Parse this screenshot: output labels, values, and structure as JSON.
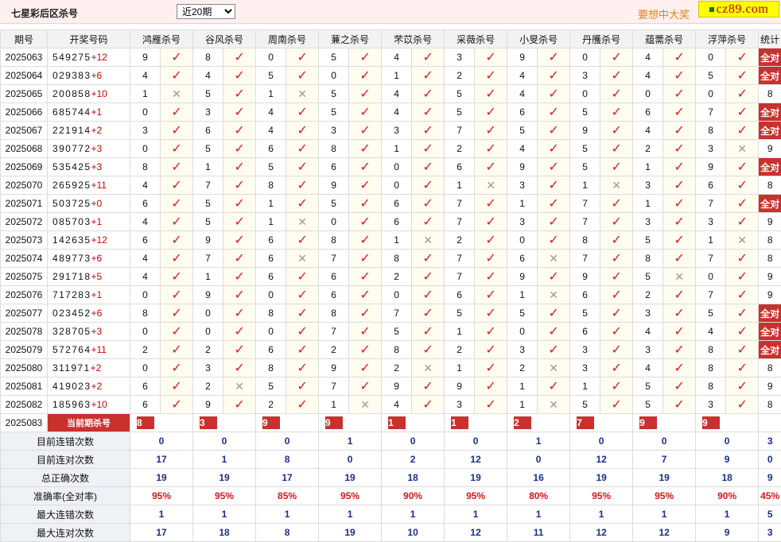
{
  "header": {
    "title": "七星彩后区杀号",
    "period_option": "近20期",
    "promo_text": "要想中大奖",
    "logo_text": "cz89.com"
  },
  "columns": {
    "issue": "期号",
    "draw": "开奖号码",
    "experts": [
      "鸿雁杀号",
      "谷风杀号",
      "周南杀号",
      "蒹之杀号",
      "芣苡杀号",
      "采薇杀号",
      "小旻杀号",
      "丹雘杀号",
      "蕴薷杀号",
      "浮萍杀号"
    ],
    "total": "统计"
  },
  "rows": [
    {
      "issue": "2025063",
      "draw": "549275",
      "plus": "+12",
      "kills": [
        [
          9,
          1
        ],
        [
          8,
          1
        ],
        [
          0,
          1
        ],
        [
          5,
          1
        ],
        [
          4,
          1
        ],
        [
          3,
          1
        ],
        [
          9,
          1
        ],
        [
          0,
          1
        ],
        [
          4,
          1
        ],
        [
          0,
          1
        ]
      ],
      "total": "全对"
    },
    {
      "issue": "2025064",
      "draw": "029383",
      "plus": "+6",
      "kills": [
        [
          4,
          1
        ],
        [
          4,
          1
        ],
        [
          5,
          1
        ],
        [
          0,
          1
        ],
        [
          1,
          1
        ],
        [
          2,
          1
        ],
        [
          4,
          1
        ],
        [
          3,
          1
        ],
        [
          4,
          1
        ],
        [
          5,
          1
        ]
      ],
      "total": "全对"
    },
    {
      "issue": "2025065",
      "draw": "200858",
      "plus": "+10",
      "kills": [
        [
          1,
          0
        ],
        [
          5,
          1
        ],
        [
          1,
          0
        ],
        [
          5,
          1
        ],
        [
          4,
          1
        ],
        [
          5,
          1
        ],
        [
          4,
          1
        ],
        [
          0,
          1
        ],
        [
          0,
          1
        ],
        [
          0,
          1
        ]
      ],
      "total": "8"
    },
    {
      "issue": "2025066",
      "draw": "685744",
      "plus": "+1",
      "kills": [
        [
          0,
          1
        ],
        [
          3,
          1
        ],
        [
          4,
          1
        ],
        [
          5,
          1
        ],
        [
          4,
          1
        ],
        [
          5,
          1
        ],
        [
          6,
          1
        ],
        [
          5,
          1
        ],
        [
          6,
          1
        ],
        [
          7,
          1
        ]
      ],
      "total": "全对"
    },
    {
      "issue": "2025067",
      "draw": "221914",
      "plus": "+2",
      "kills": [
        [
          3,
          1
        ],
        [
          6,
          1
        ],
        [
          4,
          1
        ],
        [
          3,
          1
        ],
        [
          3,
          1
        ],
        [
          7,
          1
        ],
        [
          5,
          1
        ],
        [
          9,
          1
        ],
        [
          4,
          1
        ],
        [
          8,
          1
        ]
      ],
      "total": "全对"
    },
    {
      "issue": "2025068",
      "draw": "390772",
      "plus": "+3",
      "kills": [
        [
          0,
          1
        ],
        [
          5,
          1
        ],
        [
          6,
          1
        ],
        [
          8,
          1
        ],
        [
          1,
          1
        ],
        [
          2,
          1
        ],
        [
          4,
          1
        ],
        [
          5,
          1
        ],
        [
          2,
          1
        ],
        [
          3,
          0
        ]
      ],
      "total": "9"
    },
    {
      "issue": "2025069",
      "draw": "535425",
      "plus": "+3",
      "kills": [
        [
          8,
          1
        ],
        [
          1,
          1
        ],
        [
          5,
          1
        ],
        [
          6,
          1
        ],
        [
          0,
          1
        ],
        [
          6,
          1
        ],
        [
          9,
          1
        ],
        [
          5,
          1
        ],
        [
          1,
          1
        ],
        [
          9,
          1
        ]
      ],
      "total": "全对"
    },
    {
      "issue": "2025070",
      "draw": "265925",
      "plus": "+11",
      "kills": [
        [
          4,
          1
        ],
        [
          7,
          1
        ],
        [
          8,
          1
        ],
        [
          9,
          1
        ],
        [
          0,
          1
        ],
        [
          1,
          0
        ],
        [
          3,
          1
        ],
        [
          1,
          0
        ],
        [
          3,
          1
        ],
        [
          6,
          1
        ]
      ],
      "total": "8"
    },
    {
      "issue": "2025071",
      "draw": "503725",
      "plus": "+0",
      "kills": [
        [
          6,
          1
        ],
        [
          5,
          1
        ],
        [
          1,
          1
        ],
        [
          5,
          1
        ],
        [
          6,
          1
        ],
        [
          7,
          1
        ],
        [
          1,
          1
        ],
        [
          7,
          1
        ],
        [
          1,
          1
        ],
        [
          7,
          1
        ]
      ],
      "total": "全对"
    },
    {
      "issue": "2025072",
      "draw": "085703",
      "plus": "+1",
      "kills": [
        [
          4,
          1
        ],
        [
          5,
          1
        ],
        [
          1,
          0
        ],
        [
          0,
          1
        ],
        [
          6,
          1
        ],
        [
          7,
          1
        ],
        [
          3,
          1
        ],
        [
          7,
          1
        ],
        [
          3,
          1
        ],
        [
          3,
          1
        ]
      ],
      "total": "9"
    },
    {
      "issue": "2025073",
      "draw": "142635",
      "plus": "+12",
      "kills": [
        [
          6,
          1
        ],
        [
          9,
          1
        ],
        [
          6,
          1
        ],
        [
          8,
          1
        ],
        [
          1,
          0
        ],
        [
          2,
          1
        ],
        [
          0,
          1
        ],
        [
          8,
          1
        ],
        [
          5,
          1
        ],
        [
          1,
          0
        ]
      ],
      "total": "8"
    },
    {
      "issue": "2025074",
      "draw": "489773",
      "plus": "+6",
      "kills": [
        [
          4,
          1
        ],
        [
          7,
          1
        ],
        [
          6,
          0
        ],
        [
          7,
          1
        ],
        [
          8,
          1
        ],
        [
          7,
          1
        ],
        [
          6,
          0
        ],
        [
          7,
          1
        ],
        [
          8,
          1
        ],
        [
          7,
          1
        ]
      ],
      "total": "8"
    },
    {
      "issue": "2025075",
      "draw": "291718",
      "plus": "+5",
      "kills": [
        [
          4,
          1
        ],
        [
          1,
          1
        ],
        [
          6,
          1
        ],
        [
          6,
          1
        ],
        [
          2,
          1
        ],
        [
          7,
          1
        ],
        [
          9,
          1
        ],
        [
          9,
          1
        ],
        [
          5,
          0
        ],
        [
          0,
          1
        ]
      ],
      "total": "9"
    },
    {
      "issue": "2025076",
      "draw": "717283",
      "plus": "+1",
      "kills": [
        [
          0,
          1
        ],
        [
          9,
          1
        ],
        [
          0,
          1
        ],
        [
          6,
          1
        ],
        [
          0,
          1
        ],
        [
          6,
          1
        ],
        [
          1,
          0
        ],
        [
          6,
          1
        ],
        [
          2,
          1
        ],
        [
          7,
          1
        ]
      ],
      "total": "9"
    },
    {
      "issue": "2025077",
      "draw": "023452",
      "plus": "+6",
      "kills": [
        [
          8,
          1
        ],
        [
          0,
          1
        ],
        [
          8,
          1
        ],
        [
          8,
          1
        ],
        [
          7,
          1
        ],
        [
          5,
          1
        ],
        [
          5,
          1
        ],
        [
          5,
          1
        ],
        [
          3,
          1
        ],
        [
          5,
          1
        ]
      ],
      "total": "全对"
    },
    {
      "issue": "2025078",
      "draw": "328705",
      "plus": "+3",
      "kills": [
        [
          0,
          1
        ],
        [
          0,
          1
        ],
        [
          0,
          1
        ],
        [
          7,
          1
        ],
        [
          5,
          1
        ],
        [
          1,
          1
        ],
        [
          0,
          1
        ],
        [
          6,
          1
        ],
        [
          4,
          1
        ],
        [
          4,
          1
        ]
      ],
      "total": "全对"
    },
    {
      "issue": "2025079",
      "draw": "572764",
      "plus": "+11",
      "kills": [
        [
          2,
          1
        ],
        [
          2,
          1
        ],
        [
          6,
          1
        ],
        [
          2,
          1
        ],
        [
          8,
          1
        ],
        [
          2,
          1
        ],
        [
          3,
          1
        ],
        [
          3,
          1
        ],
        [
          3,
          1
        ],
        [
          8,
          1
        ]
      ],
      "total": "全对"
    },
    {
      "issue": "2025080",
      "draw": "311971",
      "plus": "+2",
      "kills": [
        [
          0,
          1
        ],
        [
          3,
          1
        ],
        [
          8,
          1
        ],
        [
          9,
          1
        ],
        [
          2,
          0
        ],
        [
          1,
          1
        ],
        [
          2,
          0
        ],
        [
          3,
          1
        ],
        [
          4,
          1
        ],
        [
          8,
          1
        ]
      ],
      "total": "8"
    },
    {
      "issue": "2025081",
      "draw": "419023",
      "plus": "+2",
      "kills": [
        [
          6,
          1
        ],
        [
          2,
          0
        ],
        [
          5,
          1
        ],
        [
          7,
          1
        ],
        [
          9,
          1
        ],
        [
          9,
          1
        ],
        [
          1,
          1
        ],
        [
          1,
          1
        ],
        [
          5,
          1
        ],
        [
          8,
          1
        ]
      ],
      "total": "9"
    },
    {
      "issue": "2025082",
      "draw": "185963",
      "plus": "+10",
      "kills": [
        [
          6,
          1
        ],
        [
          9,
          1
        ],
        [
          2,
          1
        ],
        [
          1,
          0
        ],
        [
          4,
          1
        ],
        [
          3,
          1
        ],
        [
          1,
          0
        ],
        [
          5,
          1
        ],
        [
          5,
          1
        ],
        [
          3,
          1
        ]
      ],
      "total": "8"
    }
  ],
  "current": {
    "issue": "2025083",
    "label": "当前期杀号",
    "kills": [
      "8",
      "3",
      "9",
      "9",
      "1",
      "1",
      "2",
      "7",
      "9",
      "9"
    ]
  },
  "stats": [
    {
      "label": "目前连错次数",
      "values": [
        "0",
        "0",
        "0",
        "1",
        "0",
        "0",
        "1",
        "0",
        "0",
        "0"
      ],
      "total": "3"
    },
    {
      "label": "目前连对次数",
      "values": [
        "17",
        "1",
        "8",
        "0",
        "2",
        "12",
        "0",
        "12",
        "7",
        "9"
      ],
      "total": "0"
    },
    {
      "label": "总正确次数",
      "values": [
        "19",
        "19",
        "17",
        "19",
        "18",
        "19",
        "16",
        "19",
        "19",
        "18"
      ],
      "total": "9"
    },
    {
      "label": "准确率(全对率)",
      "values": [
        "95%",
        "95%",
        "85%",
        "95%",
        "90%",
        "95%",
        "80%",
        "95%",
        "95%",
        "90%"
      ],
      "total": "45%",
      "pct": true
    },
    {
      "label": "最大连错次数",
      "values": [
        "1",
        "1",
        "1",
        "1",
        "1",
        "1",
        "1",
        "1",
        "1",
        "1"
      ],
      "total": "5"
    },
    {
      "label": "最大连对次数",
      "values": [
        "17",
        "18",
        "8",
        "19",
        "10",
        "12",
        "11",
        "12",
        "12",
        "9"
      ],
      "total": "3"
    }
  ],
  "icons": {
    "correct": "check-icon",
    "wrong": "cross-icon"
  },
  "colors": {
    "accent": "#c8312e",
    "check": "#e01c1c",
    "stat_value": "#1a2e8c",
    "header_band": "#fff0ef",
    "promo": "#e8801a"
  }
}
